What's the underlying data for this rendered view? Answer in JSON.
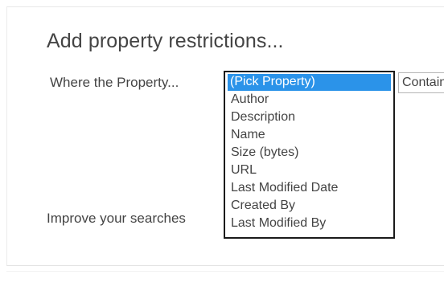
{
  "section": {
    "heading": "Add property restrictions...",
    "where_label": "Where the Property...",
    "improve_label": "Improve your searches"
  },
  "property_select": {
    "options": [
      "(Pick Property)",
      "Author",
      "Description",
      "Name",
      "Size (bytes)",
      "URL",
      "Last Modified Date",
      "Created By",
      "Last Modified By"
    ],
    "selected_index": 0
  },
  "operator_select": {
    "value": "Contains"
  },
  "colors": {
    "selection_highlight": "#2b93e9",
    "text": "#444444",
    "listbox_border": "#1a1a1a"
  }
}
